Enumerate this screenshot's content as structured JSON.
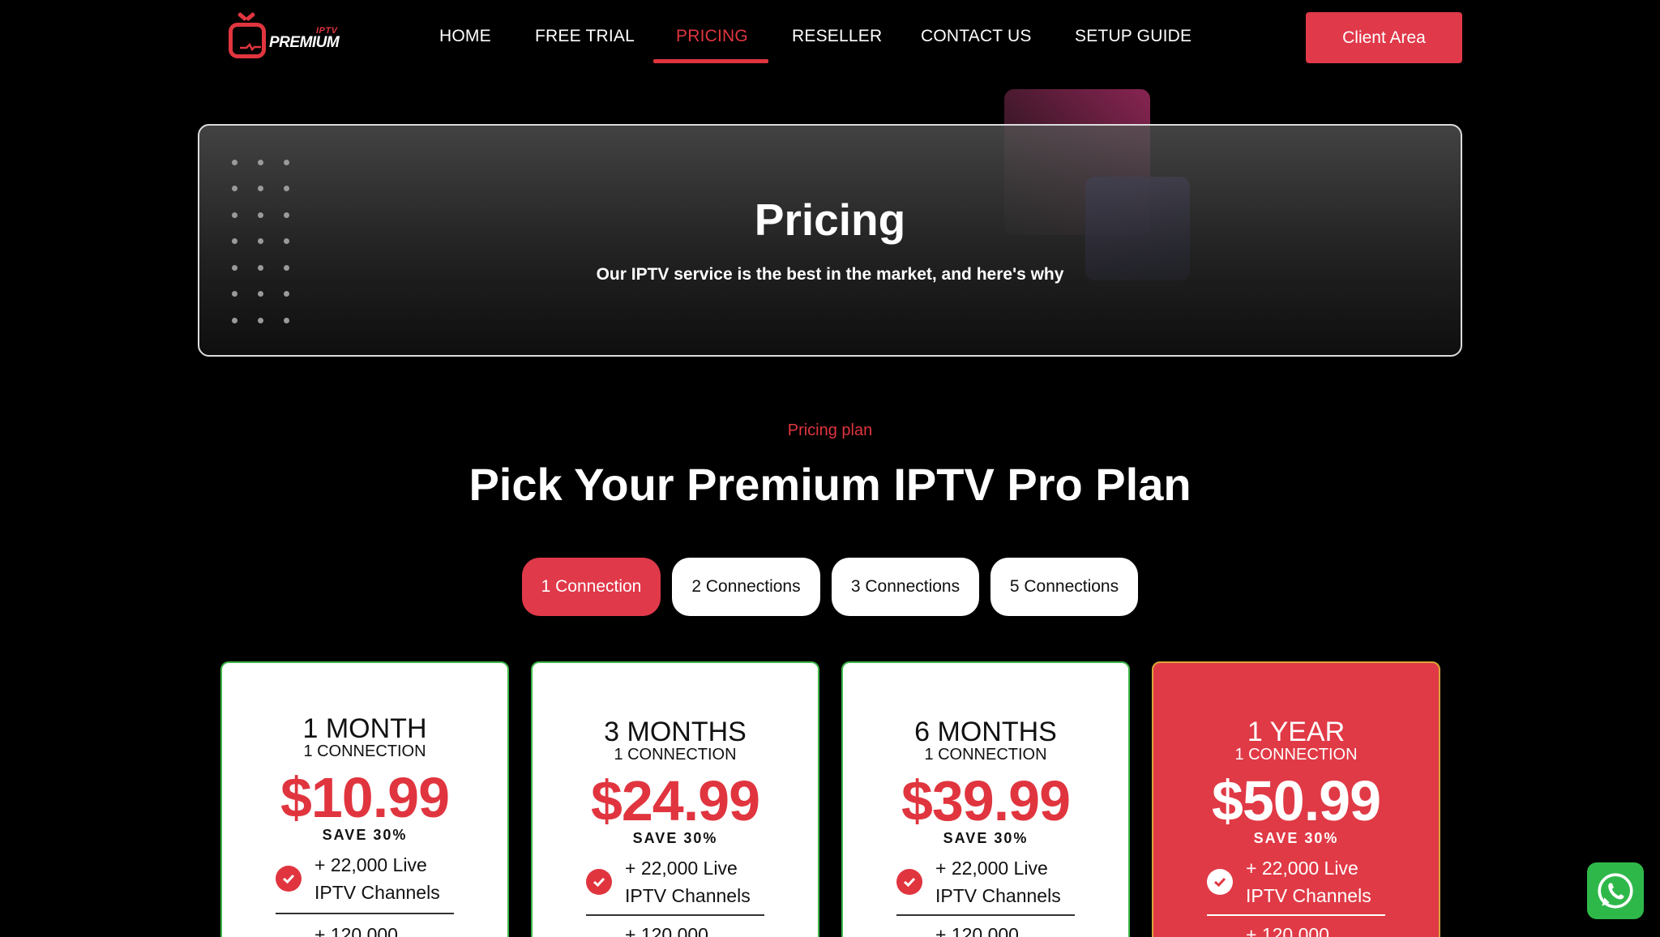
{
  "logo": {
    "iptv": "IPTV",
    "premium": "PREMIUM"
  },
  "nav": {
    "items": [
      {
        "label": "HOME"
      },
      {
        "label": "FREE TRIAL"
      },
      {
        "label": "PRICING"
      },
      {
        "label": "RESELLER"
      },
      {
        "label": "CONTACT US"
      },
      {
        "label": "SETUP GUIDE"
      }
    ],
    "active": "PRICING",
    "client_button": "Client Area"
  },
  "hero": {
    "title": "Pricing",
    "subtitle": "Our IPTV service is the best in the market, and here's why"
  },
  "section": {
    "eyebrow": "Pricing plan",
    "title": "Pick Your Premium IPTV Pro Plan"
  },
  "connection_tabs": {
    "options": [
      "1 Connection",
      "2 Connections",
      "3 Connections",
      "5 Connections"
    ],
    "selected": "1 Connection"
  },
  "plans": [
    {
      "name": "1 MONTH",
      "connection": "1 CONNECTION",
      "price": "$10.99",
      "save": "SAVE 30%",
      "feature_1": "+ 22,000 Live IPTV Channels",
      "feature_2": "+ 120,000"
    },
    {
      "name": "3 MONTHS",
      "connection": "1 CONNECTION",
      "price": "$24.99",
      "save": "SAVE 30%",
      "feature_1": "+ 22,000 Live IPTV Channels",
      "feature_2": "+ 120,000"
    },
    {
      "name": "6 MONTHS",
      "connection": "1 CONNECTION",
      "price": "$39.99",
      "save": "SAVE 30%",
      "feature_1": "+ 22,000 Live IPTV Channels",
      "feature_2": "+ 120,000"
    },
    {
      "name": "1 YEAR",
      "connection": "1 CONNECTION",
      "price": "$50.99",
      "save": "SAVE 30%",
      "feature_1": "+ 22,000 Live IPTV Channels",
      "feature_2": "+ 120,000"
    }
  ],
  "colors": {
    "accent": "#e0353f",
    "background": "#000000",
    "card_border": "#3fb54a",
    "whatsapp": "#2fb84a"
  },
  "icons": {
    "check": "check-circle-icon",
    "whatsapp": "whatsapp-icon",
    "logo": "tv-logo-icon"
  }
}
